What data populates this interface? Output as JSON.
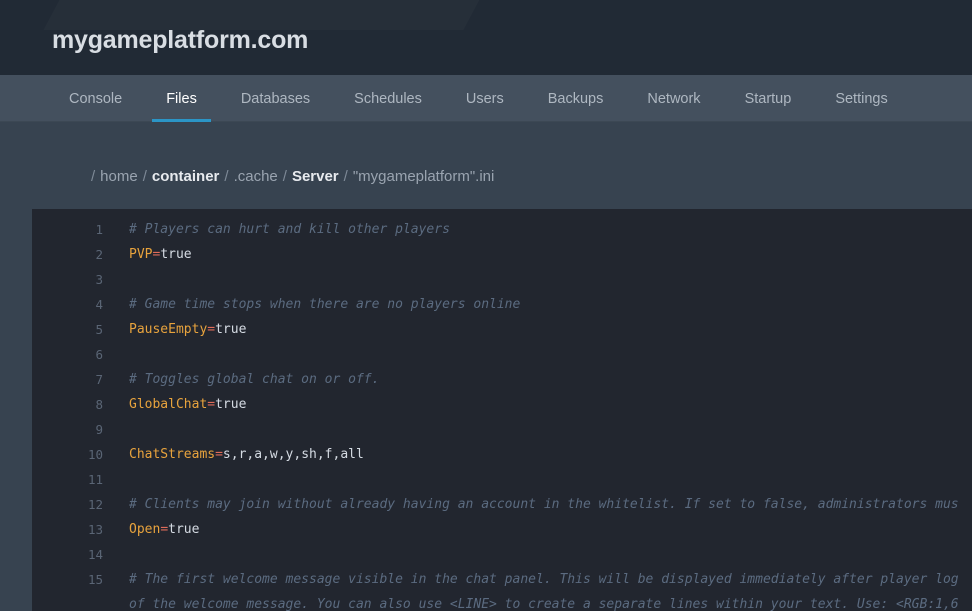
{
  "header": {
    "site_title": "mygameplatform.com"
  },
  "nav": {
    "items": [
      {
        "label": "Console",
        "active": false
      },
      {
        "label": "Files",
        "active": true
      },
      {
        "label": "Databases",
        "active": false
      },
      {
        "label": "Schedules",
        "active": false
      },
      {
        "label": "Users",
        "active": false
      },
      {
        "label": "Backups",
        "active": false
      },
      {
        "label": "Network",
        "active": false
      },
      {
        "label": "Startup",
        "active": false
      },
      {
        "label": "Settings",
        "active": false
      }
    ],
    "active_underline_color": "#2b95c6"
  },
  "breadcrumb": {
    "separator": "/",
    "lead_separator": "/",
    "items": [
      {
        "label": "home",
        "style": "plain"
      },
      {
        "label": "container",
        "style": "link"
      },
      {
        "label": ".cache",
        "style": "plain"
      },
      {
        "label": "Server",
        "style": "link"
      },
      {
        "label": "\"mygameplatform\".ini",
        "style": "file"
      }
    ]
  },
  "editor": {
    "filename": "\"mygameplatform\".ini",
    "colors": {
      "background": "#22262f",
      "gutter_text": "#5a6575",
      "comment": "#5b6b80",
      "key": "#e8a33d",
      "equals": "#e06c5a",
      "value": "#d5dbe3"
    },
    "lines": [
      {
        "n": "1",
        "type": "comment",
        "text": "# Players can hurt and kill other players"
      },
      {
        "n": "2",
        "type": "kv",
        "key": "PVP",
        "eq": "=",
        "value": "true"
      },
      {
        "n": "3",
        "type": "blank",
        "text": ""
      },
      {
        "n": "4",
        "type": "comment",
        "text": "# Game time stops when there are no players online"
      },
      {
        "n": "5",
        "type": "kv",
        "key": "PauseEmpty",
        "eq": "=",
        "value": "true"
      },
      {
        "n": "6",
        "type": "blank",
        "text": ""
      },
      {
        "n": "7",
        "type": "comment",
        "text": "# Toggles global chat on or off."
      },
      {
        "n": "8",
        "type": "kv",
        "key": "GlobalChat",
        "eq": "=",
        "value": "true"
      },
      {
        "n": "9",
        "type": "blank",
        "text": ""
      },
      {
        "n": "10",
        "type": "kv",
        "key": "ChatStreams",
        "eq": "=",
        "value": "s,r,a,w,y,sh,f,all"
      },
      {
        "n": "11",
        "type": "blank",
        "text": ""
      },
      {
        "n": "12",
        "type": "comment",
        "text": "# Clients may join without already having an account in the whitelist. If set to false, administrators mus"
      },
      {
        "n": "13",
        "type": "kv",
        "key": "Open",
        "eq": "=",
        "value": "true"
      },
      {
        "n": "14",
        "type": "blank",
        "text": ""
      },
      {
        "n": "15",
        "type": "comment",
        "text": "# The first welcome message visible in the chat panel. This will be displayed immediately after player log"
      },
      {
        "n": "",
        "type": "comment",
        "text": "of the welcome message. You can also use <LINE> to create a separate lines within your text. Use: <RGB:1,6"
      }
    ]
  }
}
